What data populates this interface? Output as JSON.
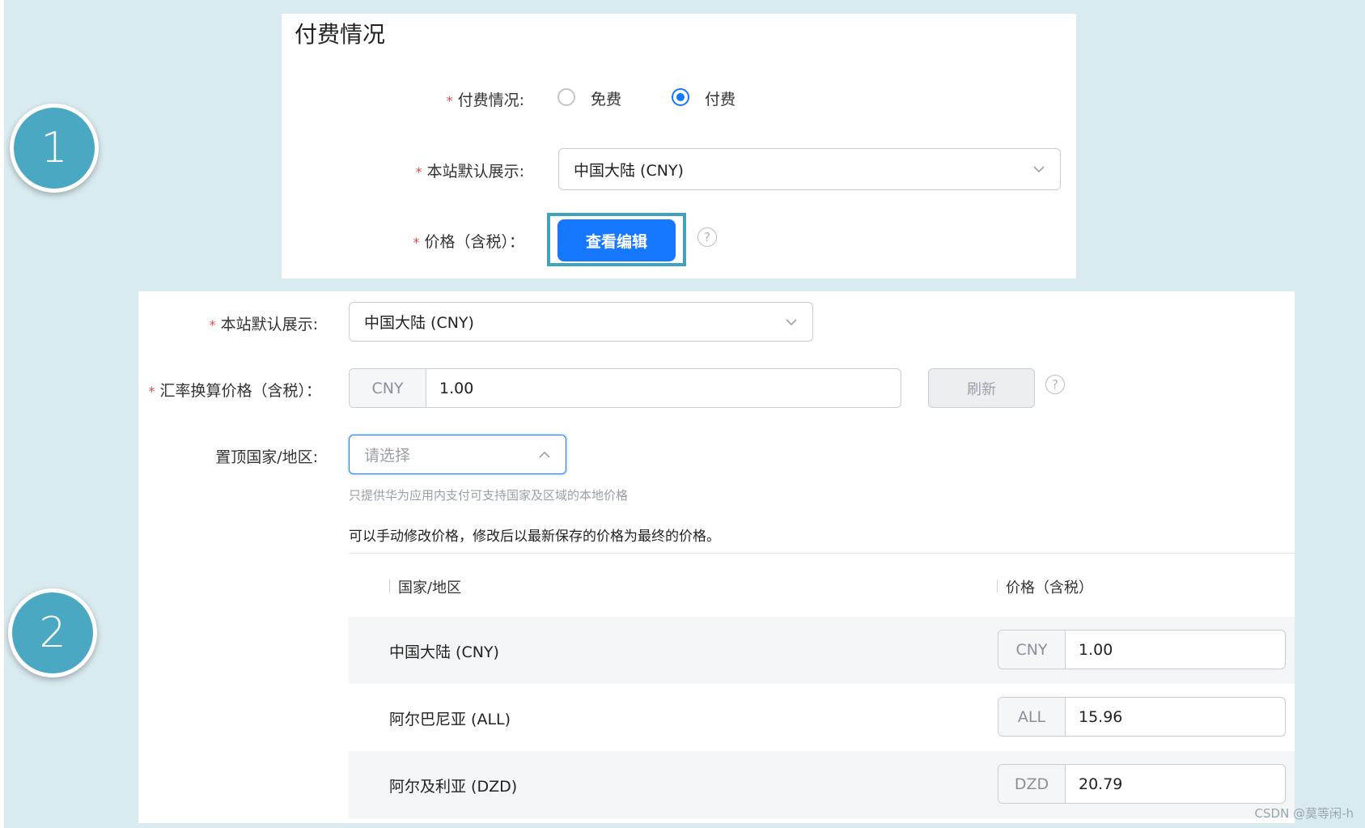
{
  "steps": [
    "1",
    "2"
  ],
  "panel1": {
    "title": "付费情况",
    "payment_label": "付费情况:",
    "options": {
      "free": "免费",
      "paid": "付费"
    },
    "selected": "paid",
    "display_label": "本站默认展示:",
    "display_value": "中国大陆 (CNY)",
    "price_label": "价格（含税）：",
    "view_edit_button": "查看编辑"
  },
  "panel2": {
    "display_label": "本站默认展示:",
    "display_value": "中国大陆 (CNY)",
    "rate_label": "汇率换算价格（含税）：",
    "rate_currency": "CNY",
    "rate_value": "1.00",
    "refresh_button": "刷新",
    "pin_label": "置顶国家/地区:",
    "pin_placeholder": "请选择",
    "hint": "只提供华为应用内支付可支持国家及区域的本地价格",
    "note": "可以手动修改价格，修改后以最新保存的价格为最终的价格。",
    "table": {
      "columns": [
        "国家/地区",
        "价格（含税）"
      ],
      "rows": [
        {
          "country": "中国大陆 (CNY)",
          "currency": "CNY",
          "price": "1.00"
        },
        {
          "country": "阿尔巴尼亚 (ALL)",
          "currency": "ALL",
          "price": "15.96"
        },
        {
          "country": "阿尔及利亚 (DZD)",
          "currency": "DZD",
          "price": "20.79"
        }
      ]
    }
  },
  "watermark": "CSDN @莫等闲-h",
  "colors": {
    "primary": "#1677ff",
    "step_circle": "#4aa8c3",
    "highlight_border": "#3fa3bf",
    "background": "#daebf0"
  }
}
